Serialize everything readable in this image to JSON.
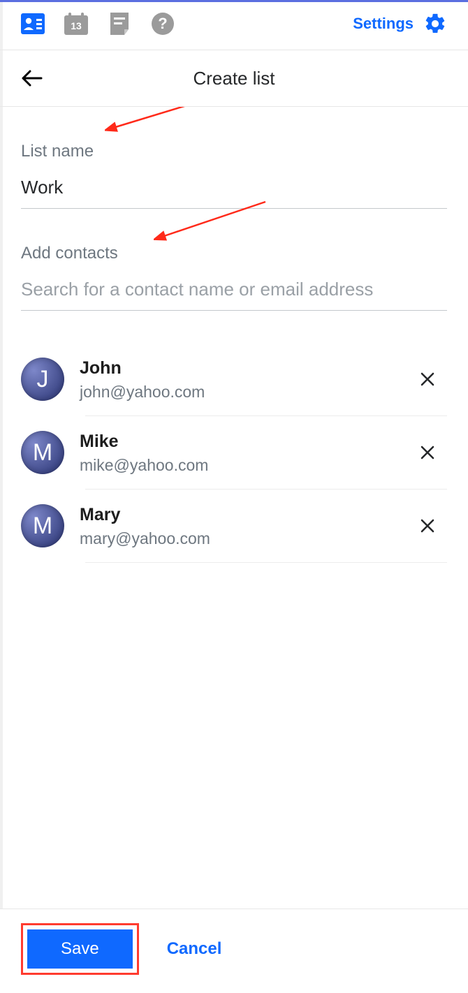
{
  "topbar": {
    "calendar_day": "13",
    "settings_label": "Settings"
  },
  "header": {
    "title": "Create list"
  },
  "form": {
    "list_name_label": "List name",
    "list_name_value": "Work",
    "add_contacts_label": "Add contacts",
    "search_placeholder": "Search for a contact name or email address"
  },
  "contacts": [
    {
      "initial": "J",
      "name": "John",
      "email": "john@yahoo.com"
    },
    {
      "initial": "M",
      "name": "Mike",
      "email": "mike@yahoo.com"
    },
    {
      "initial": "M",
      "name": "Mary",
      "email": "mary@yahoo.com"
    }
  ],
  "footer": {
    "save_label": "Save",
    "cancel_label": "Cancel"
  }
}
